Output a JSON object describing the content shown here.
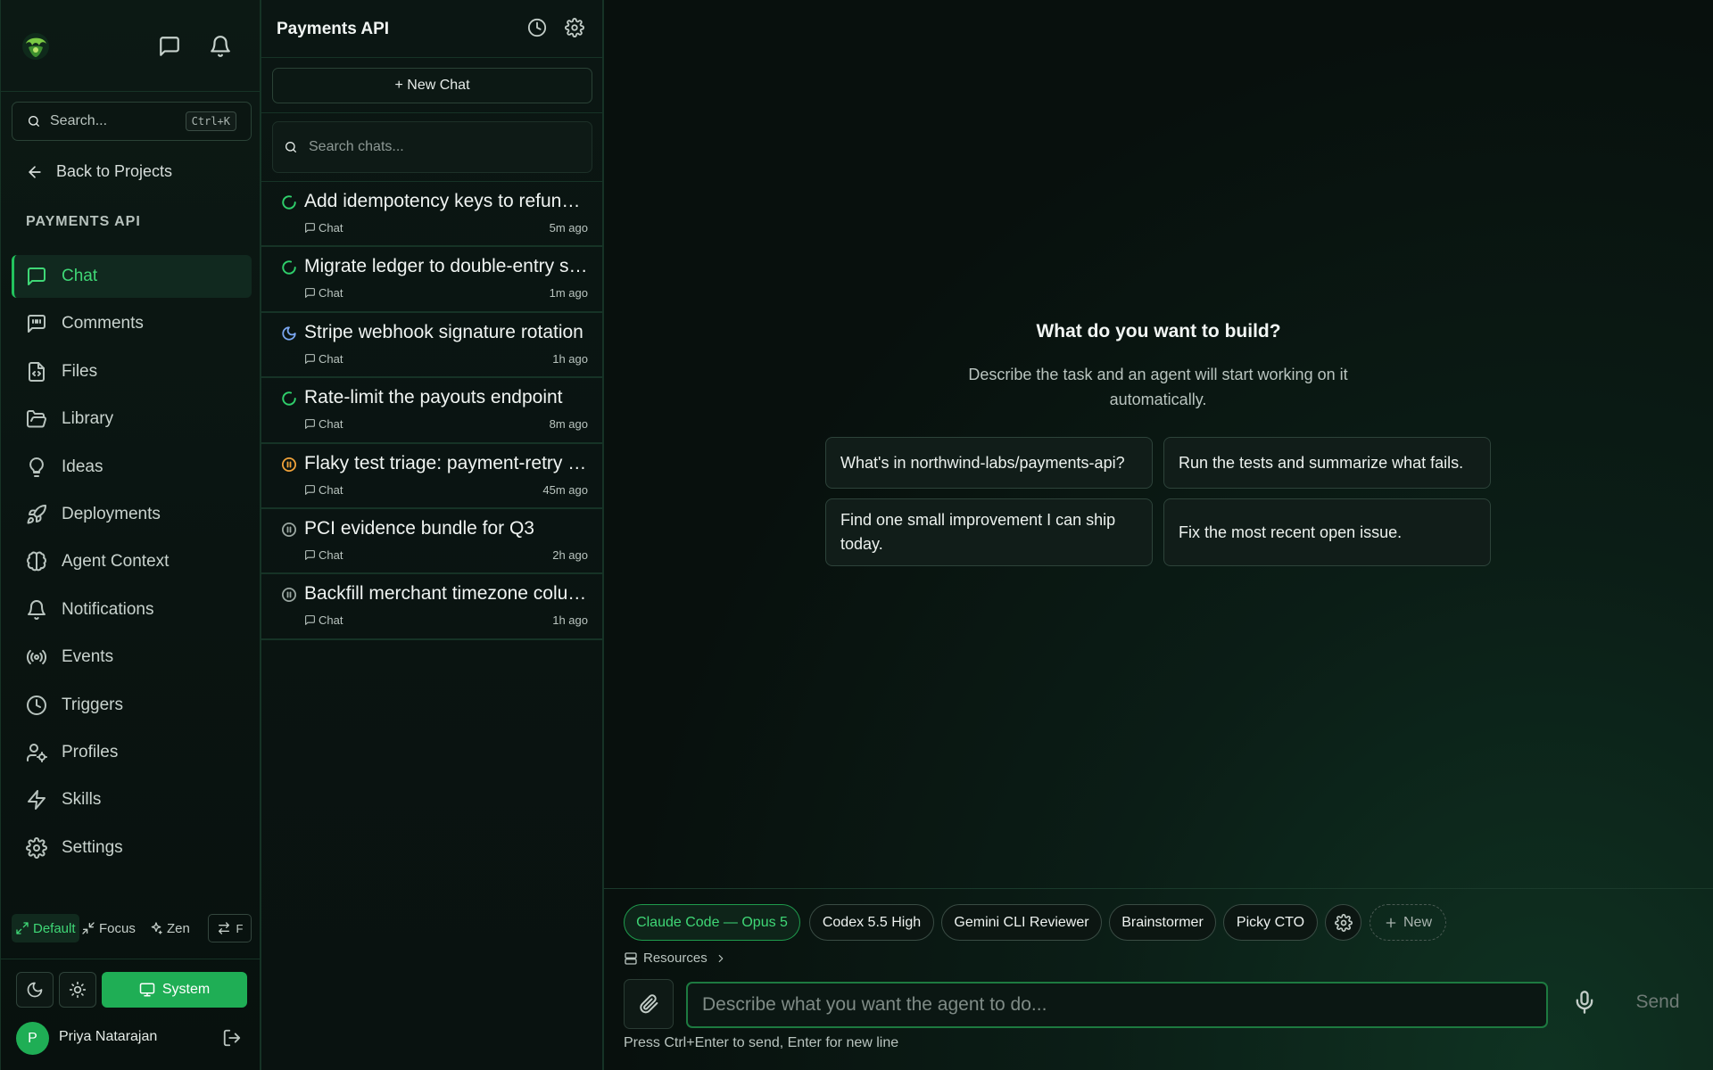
{
  "nav": {
    "search_placeholder": "Search...",
    "search_shortcut": "Ctrl+K",
    "back_label": "Back to Projects",
    "section_label": "PAYMENTS API",
    "items": [
      {
        "label": "Chat",
        "icon": "chat-icon",
        "active": true
      },
      {
        "label": "Comments",
        "icon": "comment-quote-icon"
      },
      {
        "label": "Files",
        "icon": "file-code-icon"
      },
      {
        "label": "Library",
        "icon": "folder-open-icon"
      },
      {
        "label": "Ideas",
        "icon": "lightbulb-icon"
      },
      {
        "label": "Deployments",
        "icon": "rocket-icon"
      },
      {
        "label": "Agent Context",
        "icon": "brain-icon"
      },
      {
        "label": "Notifications",
        "icon": "bell-icon"
      },
      {
        "label": "Events",
        "icon": "broadcast-icon"
      },
      {
        "label": "Triggers",
        "icon": "clock-icon"
      },
      {
        "label": "Profiles",
        "icon": "user-gear-icon"
      },
      {
        "label": "Skills",
        "icon": "lightning-icon"
      },
      {
        "label": "Settings",
        "icon": "gear-icon"
      }
    ],
    "modes": {
      "default": "Default",
      "focus": "Focus",
      "zen": "Zen",
      "swap_key": "F"
    },
    "theme_system_label": "System",
    "user": {
      "initial": "P",
      "name": "Priya Natarajan"
    },
    "accent": "#1fae55"
  },
  "pane": {
    "title": "Payments API",
    "new_chat_label": "+ New Chat",
    "search_placeholder": "Search chats...",
    "chats": [
      {
        "title": "Add idempotency keys to refund endpoint",
        "type": "Chat",
        "time": "5m ago",
        "status": "running"
      },
      {
        "title": "Migrate ledger to double-entry schema",
        "type": "Chat",
        "time": "1m ago",
        "status": "running"
      },
      {
        "title": "Stripe webhook signature rotation",
        "type": "Chat",
        "time": "1h ago",
        "status": "sleeping"
      },
      {
        "title": "Rate-limit the payouts endpoint",
        "type": "Chat",
        "time": "8m ago",
        "status": "running"
      },
      {
        "title": "Flaky test triage: payment-retry suite",
        "type": "Chat",
        "time": "45m ago",
        "status": "paused-warning"
      },
      {
        "title": "PCI evidence bundle for Q3",
        "type": "Chat",
        "time": "2h ago",
        "status": "paused"
      },
      {
        "title": "Backfill merchant timezone column",
        "type": "Chat",
        "time": "1h ago",
        "status": "paused"
      }
    ]
  },
  "main": {
    "heading": "What do you want to build?",
    "subheading": "Describe the task and an agent will start working on it automatically.",
    "suggestions": [
      "What's in northwind-labs/payments-api?",
      "Run the tests and summarize what fails.",
      "Find one small improvement I can ship today.",
      "Fix the most recent open issue."
    ],
    "agents": [
      "Claude Code — Opus 5",
      "Codex 5.5 High",
      "Gemini CLI Reviewer",
      "Brainstormer",
      "Picky CTO"
    ],
    "new_agent_label": "New",
    "resources_label": "Resources",
    "input_placeholder": "Describe what you want the agent to do...",
    "send_label": "Send",
    "hint": "Press Ctrl+Enter to send, Enter for new line"
  }
}
